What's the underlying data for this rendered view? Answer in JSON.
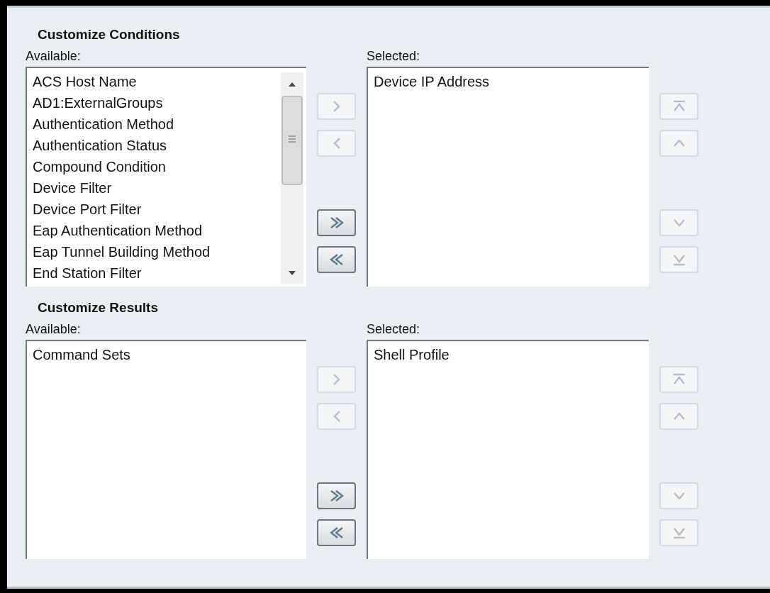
{
  "sections": [
    {
      "title": "Customize Conditions",
      "available": {
        "label": "Available:",
        "scrollbar": true,
        "items": [
          "ACS Host Name",
          "AD1:ExternalGroups",
          "Authentication Method",
          "Authentication Status",
          "Compound Condition",
          "Device Filter",
          "Device Port Filter",
          "Eap Authentication Method",
          "Eap Tunnel Building Method",
          "End Station Filter"
        ]
      },
      "move_buttons": [
        {
          "kind": "add",
          "disabled": true
        },
        {
          "kind": "remove",
          "disabled": true
        },
        {
          "kind": "add-all",
          "disabled": false
        },
        {
          "kind": "remove-all",
          "disabled": false
        }
      ],
      "selected": {
        "label": "Selected:",
        "items": [
          "Device IP Address"
        ]
      },
      "order_buttons": [
        {
          "kind": "top",
          "disabled": true
        },
        {
          "kind": "up",
          "disabled": true
        },
        {
          "kind": "down",
          "disabled": true
        },
        {
          "kind": "bottom",
          "disabled": true
        }
      ]
    },
    {
      "title": "Customize Results",
      "available": {
        "label": "Available:",
        "scrollbar": false,
        "items": [
          "Command Sets"
        ]
      },
      "move_buttons": [
        {
          "kind": "add",
          "disabled": true
        },
        {
          "kind": "remove",
          "disabled": true
        },
        {
          "kind": "add-all",
          "disabled": false
        },
        {
          "kind": "remove-all",
          "disabled": false
        }
      ],
      "selected": {
        "label": "Selected:",
        "items": [
          "Shell Profile"
        ]
      },
      "order_buttons": [
        {
          "kind": "top",
          "disabled": true
        },
        {
          "kind": "up",
          "disabled": true
        },
        {
          "kind": "down",
          "disabled": true
        },
        {
          "kind": "bottom",
          "disabled": true
        }
      ]
    }
  ]
}
